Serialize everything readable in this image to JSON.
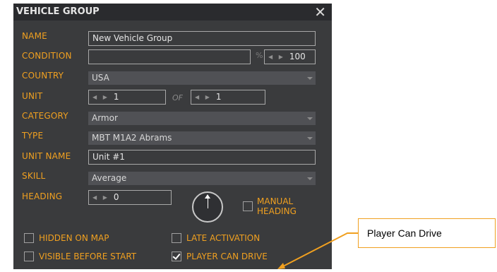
{
  "dialog": {
    "title": "VEHICLE GROUP",
    "close_glyph": "✕"
  },
  "fields": {
    "name": {
      "label": "NAME",
      "value": "New Vehicle Group"
    },
    "condition": {
      "label": "CONDITION",
      "value": "",
      "percent_symbol": "%",
      "percent_value": "100"
    },
    "country": {
      "label": "COUNTRY",
      "value": "USA"
    },
    "unit": {
      "label": "UNIT",
      "value": "1",
      "of_label": "OF",
      "of_value": "1"
    },
    "category": {
      "label": "CATEGORY",
      "value": "Armor"
    },
    "type": {
      "label": "TYPE",
      "value": "MBT M1A2 Abrams"
    },
    "unit_name": {
      "label": "UNIT NAME",
      "value": "Unit #1"
    },
    "skill": {
      "label": "SKILL",
      "value": "Average"
    },
    "heading": {
      "label": "HEADING",
      "value": "0",
      "manual_heading_line1": "MANUAL",
      "manual_heading_line2": "HEADING"
    }
  },
  "checkboxes": {
    "hidden_on_map": {
      "label": "HIDDEN ON MAP",
      "checked": false
    },
    "late_activation": {
      "label": "LATE ACTIVATION",
      "checked": false
    },
    "visible_before_start": {
      "label": "VISIBLE BEFORE START",
      "checked": false
    },
    "player_can_drive": {
      "label": "PLAYER CAN DRIVE",
      "checked": true
    },
    "manual_heading": {
      "checked": false
    }
  },
  "spinner_arrows": "◀ ▶",
  "callout": {
    "text": "Player Can Drive"
  },
  "colors": {
    "label": "#f0a020",
    "panel": "#3a3b3d",
    "titlebar": "#2a2b2e",
    "callout_border": "#f0a020"
  }
}
